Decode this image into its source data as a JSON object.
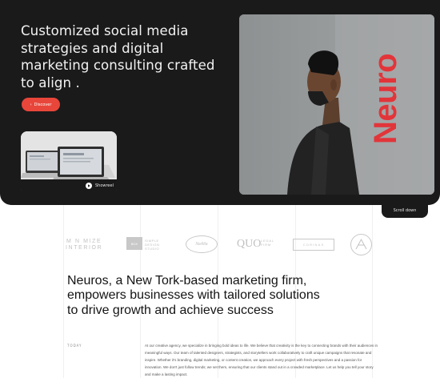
{
  "hero": {
    "headline": "Customized social media strategies and digital marketing consulting crafted to align .",
    "discover_label": "Discover",
    "showreel_label": "Showreel",
    "brand_vertical": "Neuro",
    "scroll_label": "Scroll down"
  },
  "logos": {
    "monomize": "M N MIZE\nINTERIOR",
    "box_mark": "BOX",
    "box_text": "SIMPLE\nDESIGN\nSTUDIO",
    "ellipse_text": "NeAlta",
    "quo": "QUO",
    "quo_sub": "LEGAL\nFIRM",
    "rect_text": "CORINAS"
  },
  "about": {
    "heading": "Neuros, a New Tork-based marketing firm, empowers businesses with tailored solutions to drive growth and achieve success",
    "label": "TODAY",
    "body": "At our creative agency, we specialize in bringing bold ideas to life. We believe that creativity is the key to connecting brands with their audiences in meaningful ways. Our team of talented designers, strategists, and storytellers work collaboratively to craft unique campaigns that resonate and inspire. Whether it's branding, digital marketing, or content creation, we approach every project with fresh perspectives and a passion for innovation. We don't just follow trends; we set them, ensuring that our clients stand out in a crowded marketplace. Let us help you tell your story and make a lasting impact."
  },
  "colors": {
    "hero_bg": "#1a1a1a",
    "accent": "#e2353a",
    "button": "#e8463a"
  }
}
